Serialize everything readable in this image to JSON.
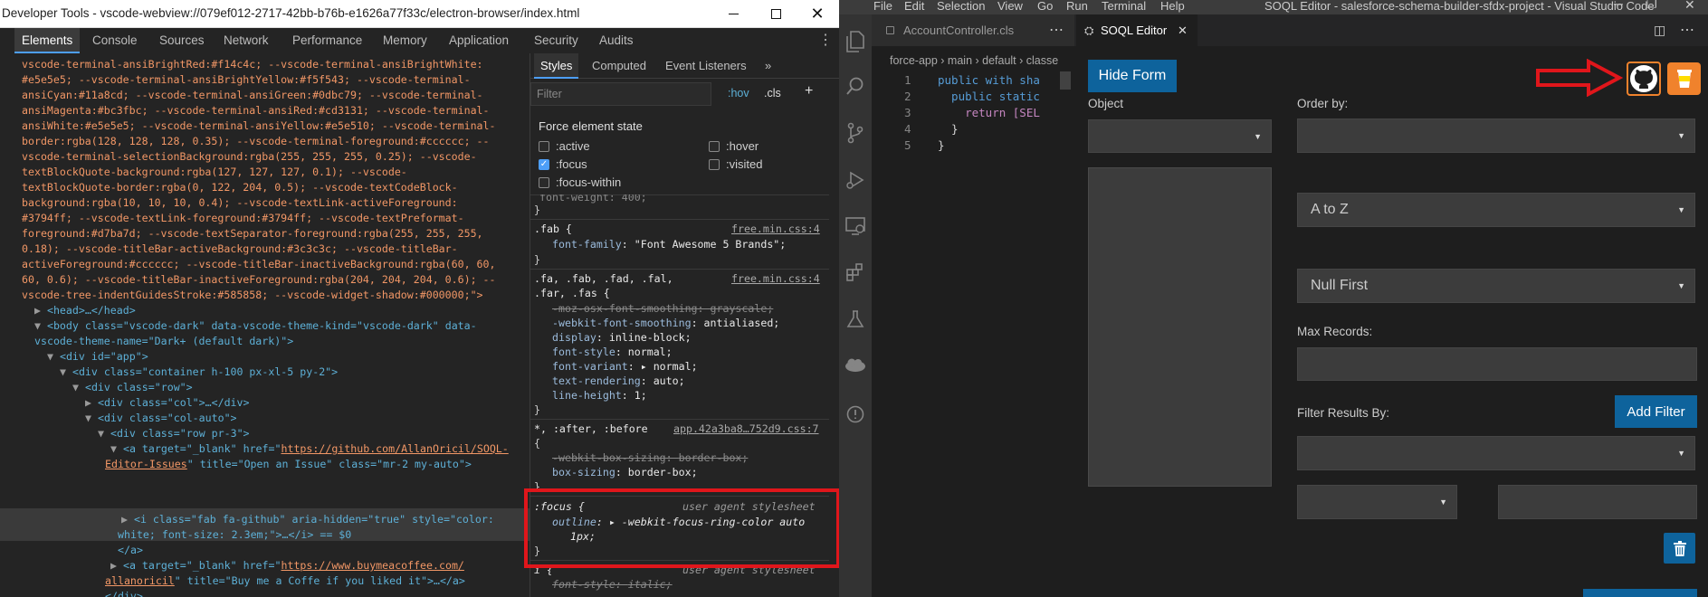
{
  "devtools": {
    "window_title": "Developer Tools - vscode-webview://079ef012-2717-42bb-b76b-e1626a77f33c/electron-browser/index.html",
    "tabs": [
      "Elements",
      "Console",
      "Sources",
      "Network",
      "Performance",
      "Memory",
      "Application",
      "Security",
      "Audits"
    ],
    "more_tabs": "»",
    "css_var_lines": [
      "vscode-terminal-ansiBrightRed:#f14c4c; --vscode-terminal-ansiBrightWhite:",
      "#e5e5e5; --vscode-terminal-ansiBrightYellow:#f5f543; --vscode-terminal-",
      "ansiCyan:#11a8cd; --vscode-terminal-ansiGreen:#0dbc79; --vscode-terminal-",
      "ansiMagenta:#bc3fbc; --vscode-terminal-ansiRed:#cd3131; --vscode-terminal-",
      "ansiWhite:#e5e5e5; --vscode-terminal-ansiYellow:#e5e510; --vscode-terminal-",
      "border:rgba(128, 128, 128, 0.35); --vscode-terminal-foreground:#cccccc; --",
      "vscode-terminal-selectionBackground:rgba(255, 255, 255, 0.25); --vscode-",
      "textBlockQuote-background:rgba(127, 127, 127, 0.1); --vscode-",
      "textBlockQuote-border:rgba(0, 122, 204, 0.5); --vscode-textCodeBlock-",
      "background:rgba(10, 10, 10, 0.4); --vscode-textLink-activeForeground:",
      "#3794ff; --vscode-textLink-foreground:#3794ff; --vscode-textPreformat-",
      "foreground:#d7ba7d; --vscode-textSeparator-foreground:rgba(255, 255, 255,",
      "0.18); --vscode-titleBar-activeBackground:#3c3c3c; --vscode-titleBar-",
      "activeForeground:#cccccc; --vscode-titleBar-inactiveBackground:rgba(60, 60,",
      "60, 0.6); --vscode-titleBar-inactiveForeground:rgba(204, 204, 204, 0.6); --",
      "vscode-tree-indentGuidesStroke:#585858; --vscode-widget-shadow:#000000;\">"
    ],
    "dom": {
      "head": "<head>…</head>",
      "body_open_1": "<body class=\"vscode-dark\" data-vscode-theme-kind=\"vscode-dark\" data-",
      "body_open_2": "vscode-theme-name=\"Dark+ (default dark)\">",
      "app_div": "<div id=\"app\">",
      "container_div": "<div class=\"container h-100 px-xl-5 py-2\">",
      "row_div": "<div class=\"row\">",
      "col_div": "<div class=\"col\">…</div>",
      "colauto_div": "<div class=\"col-auto\">",
      "rowpr3_div": "<div class=\"row pr-3\">",
      "a1_pre": "<a target=\"_blank\" href=\"",
      "a1_link": "https://github.com/AllanOricil/SOQL-",
      "a1_link2": "Editor-Issues",
      "a1_post": "\" title=\"Open an Issue\" class=\"mr-2 my-auto\">",
      "i_line1": "<i class=\"fab fa-github\" aria-hidden=\"true\" style=\"color:",
      "i_line2": "white; font-size: 2.3em;\">…</i> == $0",
      "a_close": "</a>",
      "a2_pre": "<a target=\"_blank\" href=\"",
      "a2_link": "https://www.buymeacoffee.com/",
      "a2_link2": "allanoricil",
      "a2_post": "\" title=\"Buy me a Coffe if you liked it\">…</a>",
      "div_close1": "</div>",
      "div_close2": "</div>",
      "row_div2": "<div class=\"row\">…</div>"
    },
    "styles_panel": {
      "tabs": [
        "Styles",
        "Computed",
        "Event Listeners"
      ],
      "more": "»",
      "filter_placeholder": "Filter",
      "hov": ":hov",
      "cls": ".cls",
      "plus": "+",
      "force_state_title": "Force element state",
      "states_left": [
        ":active",
        ":focus",
        ":focus-within"
      ],
      "states_right": [
        ":hover",
        ":visited"
      ],
      "focus_checked": true,
      "partial_prop": "font-weight: 400;",
      "rule1_selector": ".fab {",
      "rule1_src": "free.min.css:4",
      "rule1_prop": "font-family",
      "rule1_val": "\"Font Awesome 5 Brands\";",
      "rule2_selector1": ".fa, .fab, .fad, .fal,",
      "rule2_selector2": ".far, .fas {",
      "rule2_src": "free.min.css:4",
      "rule2_props": [
        {
          "p": "-moz-osx-font-smoothing",
          "v": "grayscale;",
          "strike": true
        },
        {
          "p": "-webkit-font-smoothing",
          "v": "antialiased;",
          "strike": false
        },
        {
          "p": "display",
          "v": "inline-block;",
          "strike": false
        },
        {
          "p": "font-style",
          "v": "normal;",
          "strike": false
        },
        {
          "p": "font-variant",
          "v": "normal;",
          "strike": false
        },
        {
          "p": "text-rendering",
          "v": "auto;",
          "strike": false
        },
        {
          "p": "line-height",
          "v": "1;",
          "strike": false
        }
      ],
      "rule3_selector": "*, :after, :before",
      "rule3_src": "app.42a3ba8…752d9.css:7",
      "rule3_props": [
        {
          "p": "-webkit-box-sizing",
          "v": "border-box;",
          "strike": true
        },
        {
          "p": "box-sizing",
          "v": "border-box;",
          "strike": false
        }
      ],
      "rule4_selector": ":focus {",
      "rule4_src": "user agent stylesheet",
      "rule4_prop": "outline",
      "rule4_val": "-webkit-focus-ring-color auto",
      "rule4_val2": "1px;",
      "rule5_selector": "i {",
      "rule5_src": "user agent stylesheet",
      "rule5_prop": "font-style",
      "rule5_val": "italic;"
    }
  },
  "vscode": {
    "menu": [
      "File",
      "Edit",
      "Selection",
      "View",
      "Go",
      "Run",
      "Terminal",
      "Help"
    ],
    "window_title": "SOQL Editor - salesforce-schema-builder-sfdx-project - Visual Studio Code",
    "tabs": [
      {
        "label": "AccountController.cls",
        "active": false
      },
      {
        "label": "SOQL Editor",
        "active": true
      }
    ],
    "breadcrumb": [
      "force-app",
      "main",
      "default",
      "classe"
    ],
    "code_lines": [
      {
        "n": "1",
        "text": "public with sha"
      },
      {
        "n": "2",
        "text": "  public static"
      },
      {
        "n": "3",
        "text": "    return [SEL"
      },
      {
        "n": "4",
        "text": "  }"
      },
      {
        "n": "5",
        "text": "}"
      }
    ],
    "soql": {
      "hide_form": "Hide Form",
      "object_label": "Object",
      "order_by_label": "Order by:",
      "order_dir": "A to Z",
      "nulls": "Null First",
      "max_records_label": "Max Records:",
      "filter_label": "Filter Results By:",
      "add_filter": "Add Filter"
    }
  },
  "colors": {
    "accent": "#0e639c",
    "highlight": "#e0161b",
    "coffee": "#f0822c"
  }
}
